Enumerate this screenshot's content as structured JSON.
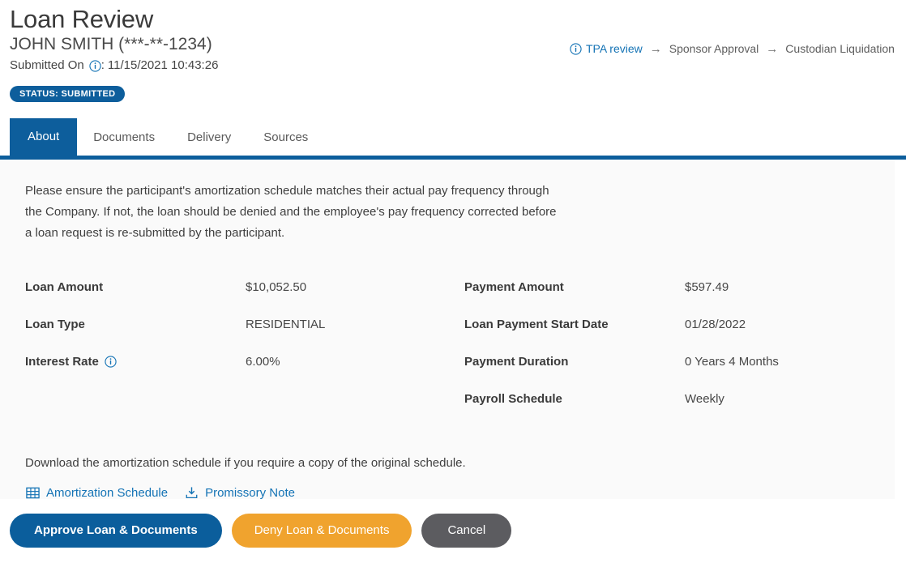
{
  "header": {
    "title": "Loan Review",
    "participant": "JOHN SMITH (***-**-1234)",
    "submitted_label": "Submitted On",
    "submitted_separator": ":",
    "submitted_value": "11/15/2021 10:43:26",
    "status_badge": "STATUS: SUBMITTED",
    "info_icon": "info-icon"
  },
  "breadcrumb": {
    "separator": "→",
    "steps": [
      {
        "label": "TPA review",
        "state": "active",
        "icon": "info-icon"
      },
      {
        "label": "Sponsor Approval",
        "state": "inactive"
      },
      {
        "label": "Custodian Liquidation",
        "state": "inactive"
      }
    ]
  },
  "tabs": [
    {
      "label": "About",
      "active": true
    },
    {
      "label": "Documents",
      "active": false
    },
    {
      "label": "Delivery",
      "active": false
    },
    {
      "label": "Sources",
      "active": false
    }
  ],
  "main": {
    "intro": "Please ensure the participant's amortization schedule matches their actual pay frequency through the Company. If not, the loan should be denied and the employee's pay frequency corrected before a loan request is re-submitted by the participant.",
    "left_fields": [
      {
        "label": "Loan Amount",
        "value": "$10,052.50",
        "info": false
      },
      {
        "label": "Loan Type",
        "value": "RESIDENTIAL",
        "info": false
      },
      {
        "label": "Interest Rate",
        "value": "6.00%",
        "info": true
      }
    ],
    "right_fields": [
      {
        "label": "Payment Amount",
        "value": "$597.49",
        "info": false
      },
      {
        "label": "Loan Payment Start Date",
        "value": "01/28/2022",
        "info": false
      },
      {
        "label": "Payment Duration",
        "value": "0 Years 4 Months",
        "info": false
      },
      {
        "label": "Payroll Schedule",
        "value": "Weekly",
        "info": false
      }
    ],
    "download_note": "Download the amortization schedule if you require a copy of the original schedule.",
    "links": [
      {
        "label": "Amortization Schedule",
        "icon": "table-grid-icon"
      },
      {
        "label": "Promissory Note",
        "icon": "download-icon"
      }
    ]
  },
  "footer": {
    "approve_label": "Approve Loan & Documents",
    "deny_label": "Deny Loan & Documents",
    "cancel_label": "Cancel"
  },
  "colors": {
    "brand_blue": "#0d5e9c",
    "link_blue": "#1473b5",
    "deny_orange": "#f0a32e",
    "cancel_gray": "#5c5c60",
    "panel_bg": "#fafafa"
  }
}
